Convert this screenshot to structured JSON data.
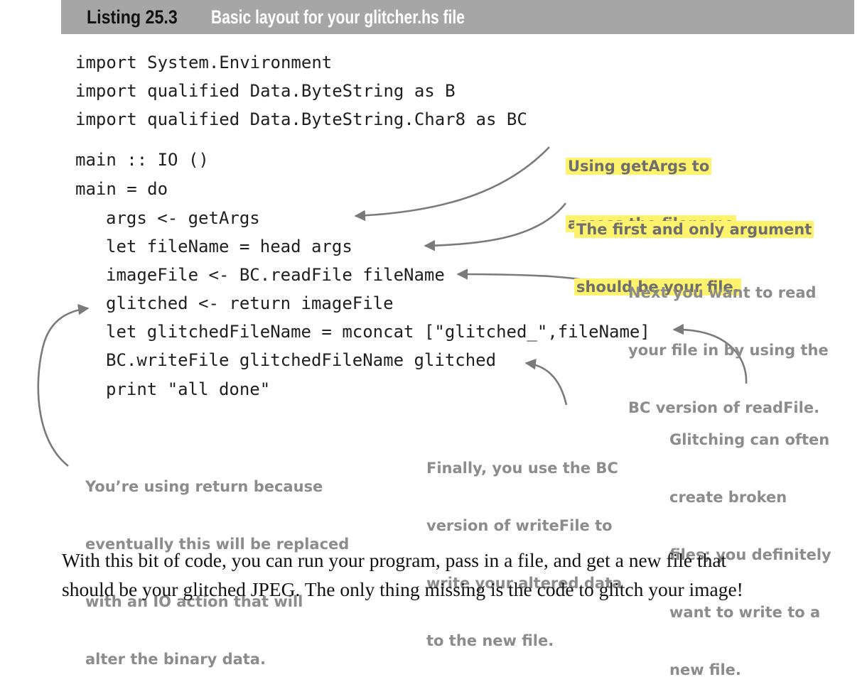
{
  "listing": {
    "number": "Listing 25.3",
    "title": "Basic layout for your glitcher.hs file"
  },
  "code_lines": [
    "import System.Environment",
    "import qualified Data.ByteString as B",
    "import qualified Data.ByteString.Char8 as BC",
    "main :: IO ()",
    "main = do",
    "args <- getArgs",
    "let fileName = head args",
    "imageFile <- BC.readFile fileName",
    "glitched <- return imageFile",
    "let glitchedFileName = mconcat [\"glitched_\",fileName]",
    "BC.writeFile glitchedFileName glitched",
    "print \"all done\""
  ],
  "annotations": {
    "getargs": [
      "Using getArgs to",
      "access the filename"
    ],
    "first_arg": [
      "The first and only argument",
      "should be your file."
    ],
    "readfile": [
      "Next you want to read",
      "your file in by using the",
      "BC version of readFile."
    ],
    "return": [
      "You’re using return because",
      "eventually this will be replaced",
      "with an IO action that will",
      "alter the binary data."
    ],
    "writefile": [
      "Finally, you use the BC",
      "version of writeFile to",
      "write your altered data",
      "to the new file."
    ],
    "glitching": [
      "Glitching can often",
      "create broken",
      "files; you definitely",
      "want to write to a",
      "new file."
    ]
  },
  "prose": [
    "With this bit of code, you can run your program, pass in a file, and get a new file that",
    "should be your glitched JPEG. The only thing missing is the code to glitch your image!"
  ],
  "colors": {
    "header_bg": "#a6a6a6",
    "highlight": "#fff36e",
    "annotation_text": "#8c8c8c",
    "arrow": "#7a7a7a"
  }
}
